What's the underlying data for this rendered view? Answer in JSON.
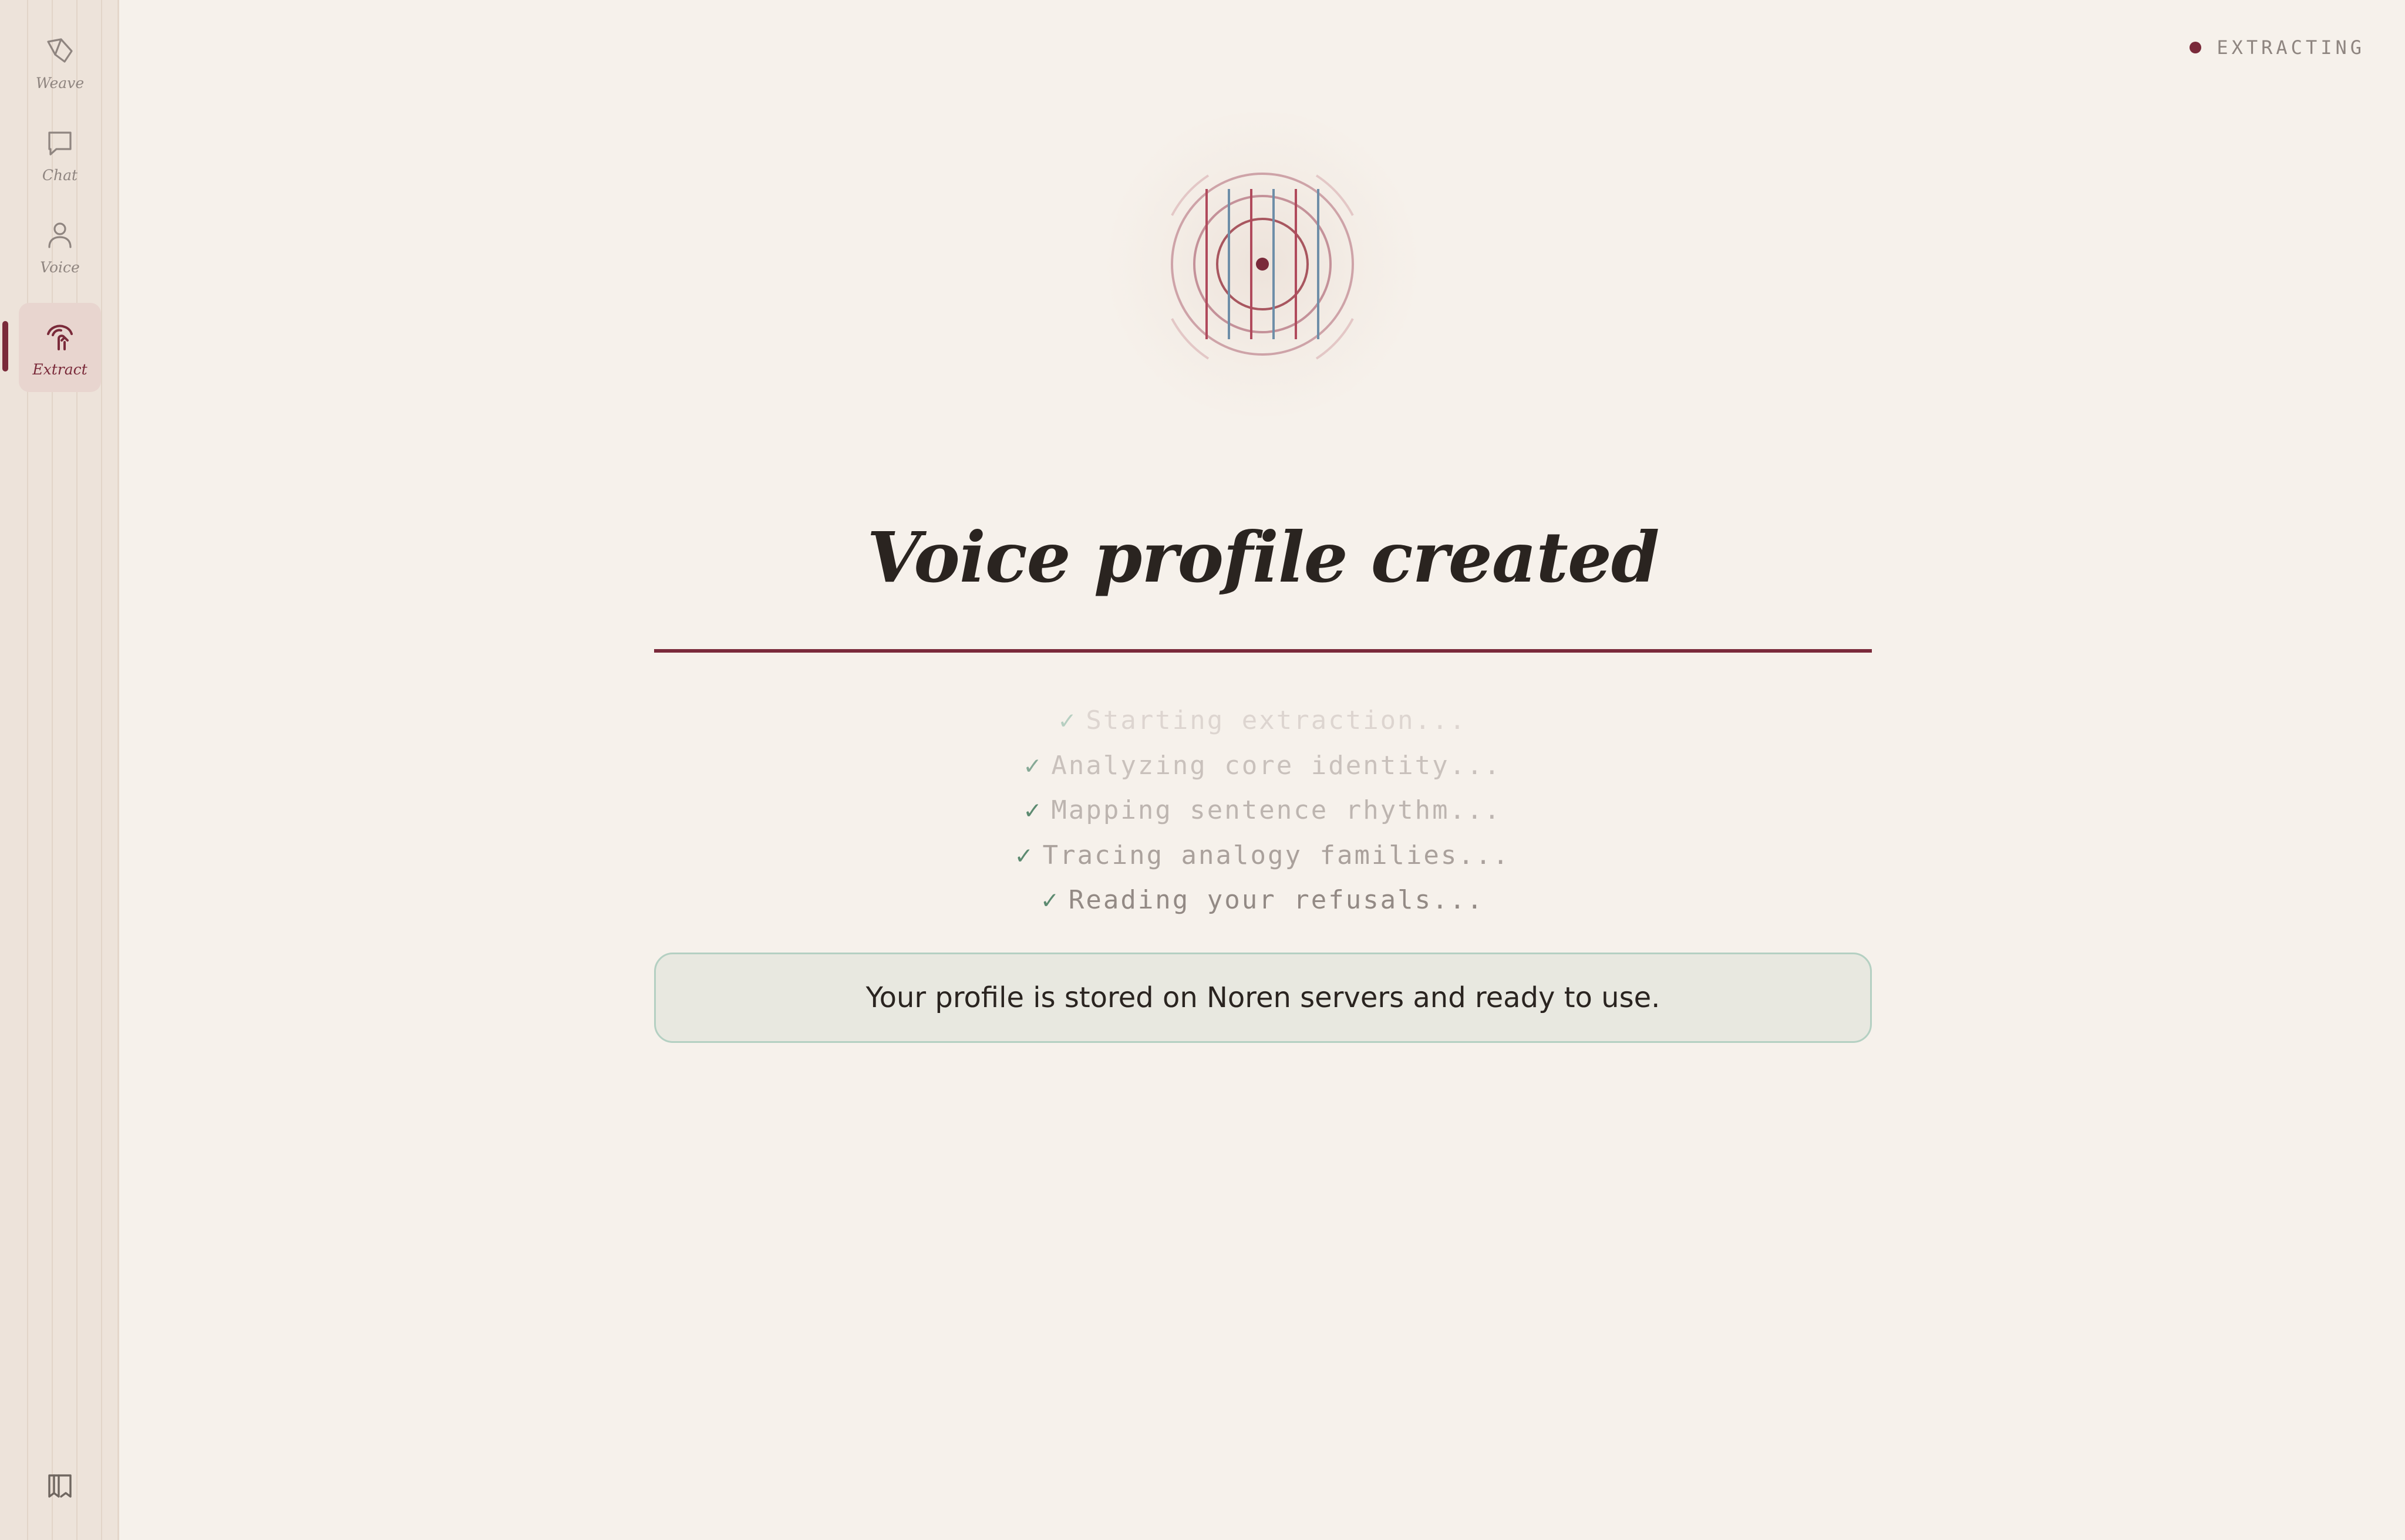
{
  "sidebar": {
    "items": [
      {
        "label": "Weave",
        "icon": "pen-nib-icon"
      },
      {
        "label": "Chat",
        "icon": "chat-bubble-icon"
      },
      {
        "label": "Voice",
        "icon": "person-icon"
      },
      {
        "label": "Extract",
        "icon": "extract-icon",
        "active": true
      }
    ],
    "bottom_icon": "book-icon"
  },
  "status": {
    "label": "EXTRACTING",
    "dot_color": "#7a2a3a"
  },
  "main": {
    "title": "Voice profile created",
    "steps": [
      {
        "check": "✓",
        "text": "Starting extraction..."
      },
      {
        "check": "✓",
        "text": "Analyzing core identity..."
      },
      {
        "check": "✓",
        "text": "Mapping sentence rhythm..."
      },
      {
        "check": "✓",
        "text": "Tracing analogy families..."
      },
      {
        "check": "✓",
        "text": "Reading your refusals..."
      }
    ],
    "notice": "Your profile is stored on Noren servers and ready to use."
  },
  "colors": {
    "accent": "#7a2a3a",
    "background": "#f6f1eb",
    "sidebar": "#ede3da",
    "success_border": "#b4d0c2",
    "success_check": "#5c8a70"
  }
}
